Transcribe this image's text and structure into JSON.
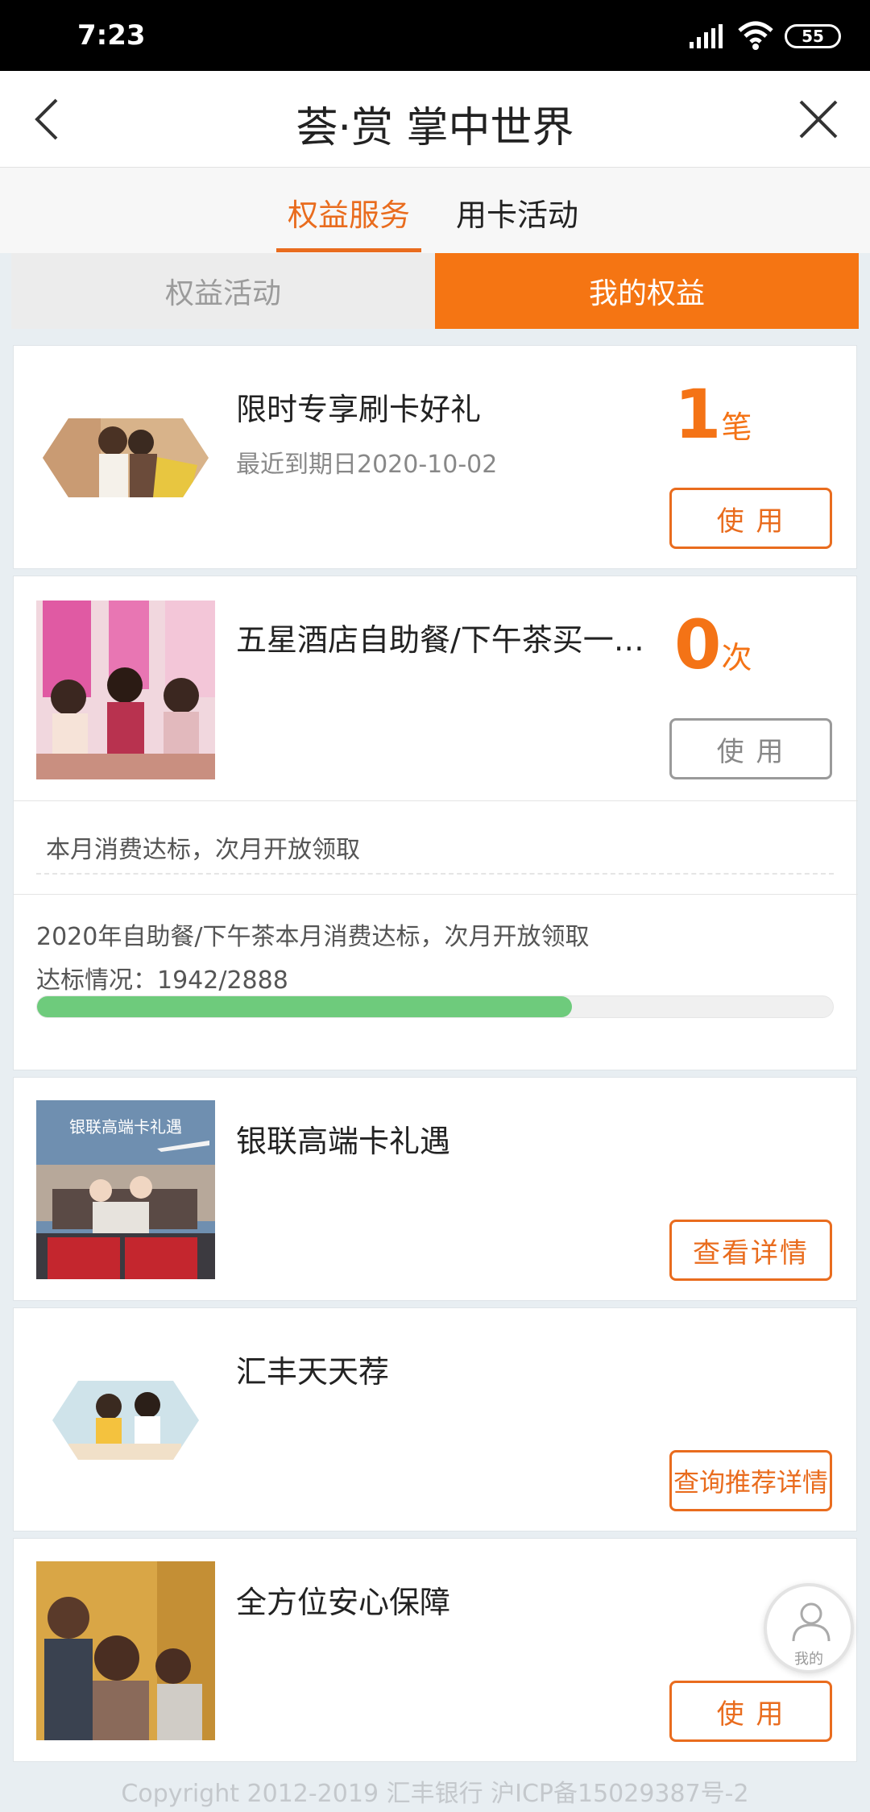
{
  "status_bar": {
    "time": "7:23",
    "battery": "55"
  },
  "header": {
    "title": "荟·赏 掌中世界"
  },
  "top_tabs": [
    {
      "label": "权益服务",
      "active": true
    },
    {
      "label": "用卡活动",
      "active": false
    }
  ],
  "segment": {
    "left": "权益活动",
    "right": "我的权益"
  },
  "cards": {
    "gift": {
      "title": "限时专享刷卡好礼",
      "subtitle": "最近到期日2020-10-02",
      "count": "1",
      "unit": "笔",
      "button": "使 用"
    },
    "buffet": {
      "title": "五星酒店自助餐/下午茶买一…",
      "count": "0",
      "unit": "次",
      "button": "使 用",
      "note": "本月消费达标，次月开放领取",
      "desc": "2020年自助餐/下午茶本月消费达标，次月开放领取",
      "progress_label": "达标情况：1942/2888",
      "progress_fraction": 0.672
    },
    "unionpay": {
      "title": "银联高端卡礼遇",
      "image_text": "银联高端卡礼遇",
      "button": "查看详情"
    },
    "hsbc": {
      "title": "汇丰天天荐",
      "button": "查询推荐详情"
    },
    "insurance": {
      "title": "全方位安心保障",
      "button": "使 用"
    }
  },
  "fab": {
    "label": "我的"
  },
  "footer": {
    "text": "Copyright 2012-2019 汇丰银行 沪ICP备15029387号-2"
  },
  "colors": {
    "accent": "#f57513",
    "progress": "#6ecb7c"
  }
}
